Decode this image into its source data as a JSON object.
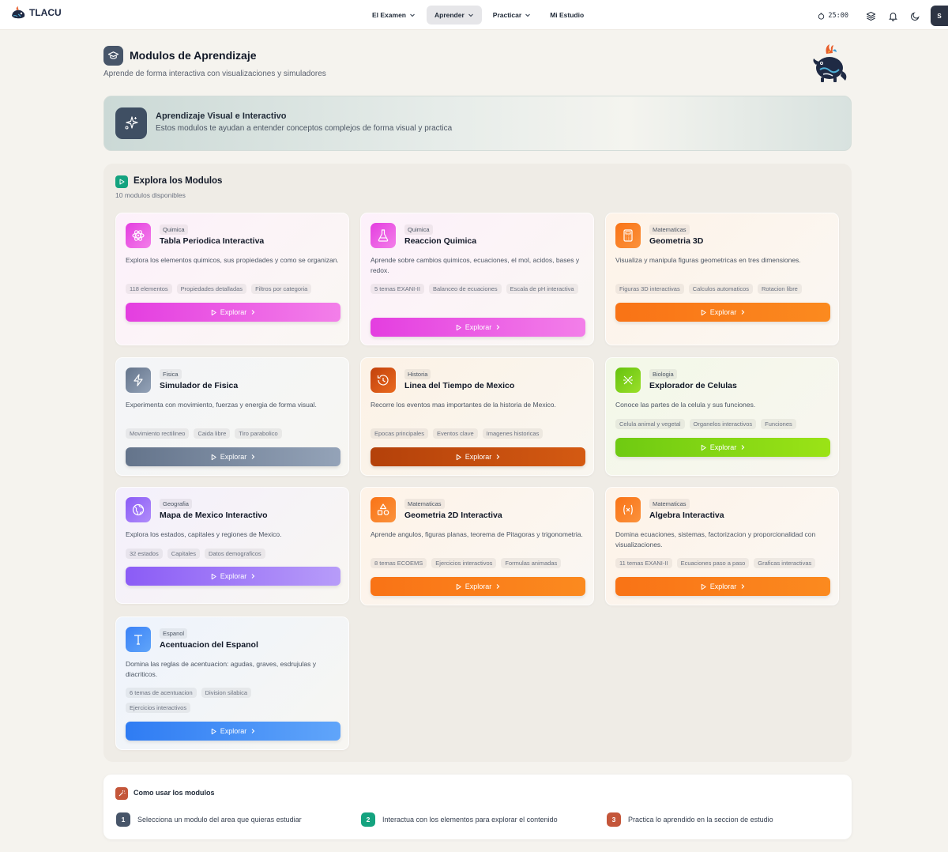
{
  "nav": {
    "brand": "TLACU",
    "items": [
      {
        "label": "El Examen",
        "has_chevron": true,
        "active": false
      },
      {
        "label": "Aprender",
        "has_chevron": true,
        "active": true
      },
      {
        "label": "Practicar",
        "has_chevron": true,
        "active": false
      },
      {
        "label": "Mi Estudio",
        "has_chevron": false,
        "active": false
      }
    ],
    "timer": "25:00",
    "avatar": "S"
  },
  "header": {
    "title": "Modulos de Aprendizaje",
    "subtitle": "Aprende de forma interactiva con visualizaciones y simuladores"
  },
  "banner": {
    "title": "Aprendizaje Visual e Interactivo",
    "subtitle": "Estos modulos te ayudan a entender conceptos complejos de forma visual y practica"
  },
  "section": {
    "title": "Explora los Modulos",
    "count": "10 modulos disponibles"
  },
  "cards": [
    {
      "category": "Quimica",
      "title": "Tabla Periodica Interactiva",
      "description": "Explora los elementos quimicos, sus propiedades y como se organizan.",
      "tags": [
        "118 elementos",
        "Propiedades detalladas",
        "Filtros por categoria"
      ],
      "button": "Explorar",
      "icon": "atom-icon",
      "accent": "#e43ee0"
    },
    {
      "category": "Quimica",
      "title": "Reaccion Quimica",
      "description": "Aprende sobre cambios quimicos, ecuaciones, el mol, acidos, bases y redox.",
      "tags": [
        "5 temas EXANI-II",
        "Balanceo de ecuaciones",
        "Escala de pH interactiva"
      ],
      "button": "Explorar",
      "icon": "flask-icon",
      "accent": "#e43ee0"
    },
    {
      "category": "Matematicas",
      "title": "Geometria 3D",
      "description": "Visualiza y manipula figuras geometricas en tres dimensiones.",
      "tags": [
        "Figuras 3D interactivas",
        "Calculos automaticos",
        "Rotacion libre"
      ],
      "button": "Explorar",
      "icon": "calculator-icon",
      "accent": "#f97316"
    },
    {
      "category": "Fisica",
      "title": "Simulador de Fisica",
      "description": "Experimenta con movimiento, fuerzas y energia de forma visual.",
      "tags": [
        "Movimiento rectilineo",
        "Caida libre",
        "Tiro parabolico"
      ],
      "button": "Explorar",
      "icon": "lightning-icon",
      "accent": "#64748b"
    },
    {
      "category": "Historia",
      "title": "Linea del Tiempo de Mexico",
      "description": "Recorre los eventos mas importantes de la historia de Mexico.",
      "tags": [
        "Epocas principales",
        "Eventos clave",
        "Imagenes historicas"
      ],
      "button": "Explorar",
      "icon": "history-icon",
      "accent": "#c2410c"
    },
    {
      "category": "Biologia",
      "title": "Explorador de Celulas",
      "description": "Conoce las partes de la celula y sus funciones.",
      "tags": [
        "Celula animal y vegetal",
        "Organelos interactivos",
        "Funciones"
      ],
      "button": "Explorar",
      "icon": "dna-icon",
      "accent": "#84cc16"
    },
    {
      "category": "Geografia",
      "title": "Mapa de Mexico Interactivo",
      "description": "Explora los estados, capitales y regiones de Mexico.",
      "tags": [
        "32 estados",
        "Capitales",
        "Datos demograficos"
      ],
      "button": "Explorar",
      "icon": "globe-icon",
      "accent": "#8b5cf6"
    },
    {
      "category": "Matematicas",
      "title": "Geometria 2D Interactiva",
      "description": "Aprende angulos, figuras planas, teorema de Pitagoras y trigonometria.",
      "tags": [
        "8 temas ECOEMS",
        "Ejercicios interactivos",
        "Formulas animadas"
      ],
      "button": "Explorar",
      "icon": "shapes-icon",
      "accent": "#f97316"
    },
    {
      "category": "Matematicas",
      "title": "Algebra Interactiva",
      "description": "Domina ecuaciones, sistemas, factorizacion y proporcionalidad con visualizaciones.",
      "tags": [
        "11 temas EXANI-II",
        "Ecuaciones paso a paso",
        "Graficas interactivas"
      ],
      "button": "Explorar",
      "icon": "variable-icon",
      "accent": "#f97316"
    },
    {
      "category": "Espanol",
      "title": "Acentuacion del Espanol",
      "description": "Domina las reglas de acentuacion: agudas, graves, esdrujulas y diacriticos.",
      "tags": [
        "6 temas de acentuacion",
        "Division silabica",
        "Ejercicios interactivos"
      ],
      "button": "Explorar",
      "icon": "text-icon",
      "accent": "#3b82f6"
    }
  ],
  "how": {
    "title": "Como usar los modulos",
    "steps": [
      {
        "num": "1",
        "text": "Selecciona un modulo del area que quieras estudiar",
        "color": "#475569"
      },
      {
        "num": "2",
        "text": "Interactua con los elementos para explorar el contenido",
        "color": "#14a37f"
      },
      {
        "num": "3",
        "text": "Practica lo aprendido en la seccion de estudio",
        "color": "#c4563a"
      }
    ]
  }
}
